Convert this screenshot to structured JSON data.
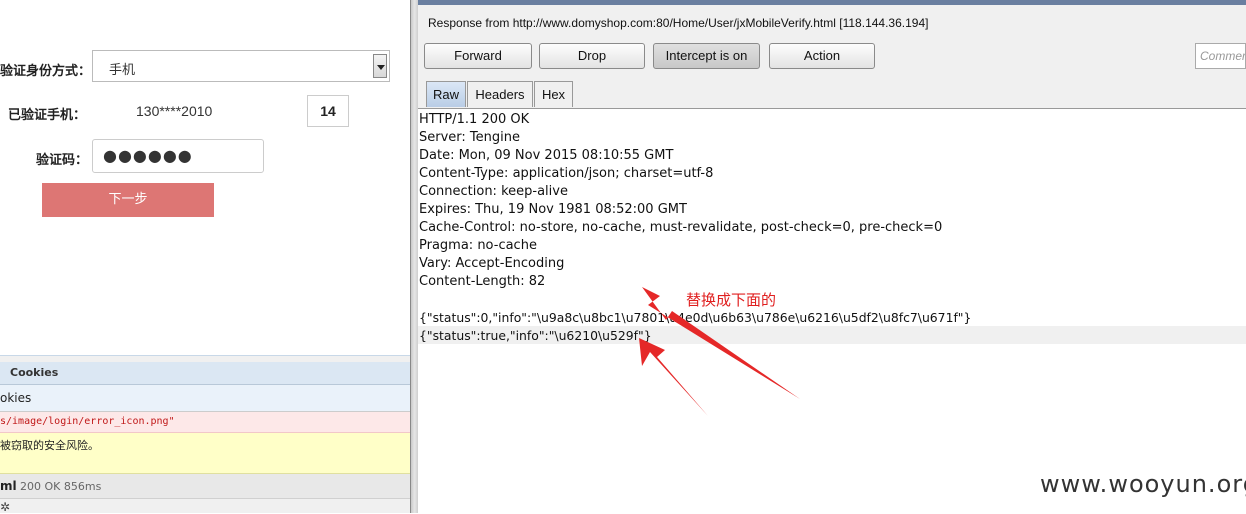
{
  "left_form": {
    "verify_method_label": "验证身份方式：",
    "verify_method_value": "手机",
    "verified_phone_label": "已验证手机：",
    "verified_phone_value": "130****2010",
    "countdown": "14",
    "code_label": "验证码：",
    "code_value": "●●●●●●",
    "next_button": "下一步"
  },
  "devtools": {
    "tab_label": "Cookies",
    "sub_label": "okies",
    "error_text": "s/image/login/error_icon.png\"",
    "warning_text": "被窃取的安全风险。",
    "net_name": "ml",
    "net_status": "200 OK 856ms"
  },
  "burp": {
    "response_from": "Response from http://www.domyshop.com:80/Home/User/jxMobileVerify.html  [118.144.36.194]",
    "buttons": [
      "Forward",
      "Drop",
      "Intercept is on",
      "Action"
    ],
    "comment_placeholder": "Comment",
    "tabs": [
      "Raw",
      "Headers",
      "Hex"
    ],
    "active_tab": "Raw",
    "lines": [
      "HTTP/1.1 200 OK",
      "Server: Tengine",
      "Date: Mon, 09 Nov 2015 08:10:55 GMT",
      "Content-Type: application/json; charset=utf-8",
      "Connection: keep-alive",
      "Expires: Thu, 19 Nov 1981 08:52:00 GMT",
      "Cache-Control: no-store, no-cache, must-revalidate, post-check=0, pre-check=0",
      "Pragma: no-cache",
      "Vary: Accept-Encoding",
      "Content-Length: 82",
      "",
      "{\"status\":0,\"info\":\"\\u9a8c\\u8bc1\\u7801\\u4e0d\\u6b63\\u786e\\u6216\\u5df2\\u8fc7\\u671f\"}",
      "{\"status\":true,\"info\":\"\\u6210\\u529f\"}"
    ]
  },
  "annotation": "替换成下面的",
  "watermark": "www.wooyun.org",
  "colors": {
    "next_button": "#dd7674",
    "annotation": "#e02020",
    "active_tab": "#c9d9ee"
  }
}
